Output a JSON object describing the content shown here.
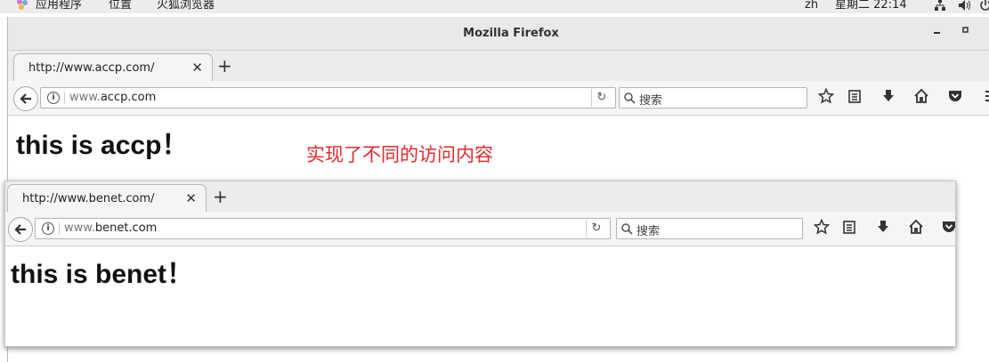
{
  "topbar": {
    "apps": "应用程序",
    "places": "位置",
    "browser": "火狐浏览器",
    "lang": "zh",
    "clock": "星期二 22:14"
  },
  "window": {
    "title": "Mozilla Firefox"
  },
  "browser1": {
    "tab_title": "http://www.accp.com/",
    "url_dim": "www.",
    "url_main": "accp.com",
    "search_placeholder": "搜索",
    "page_heading": "this is accp！"
  },
  "browser2": {
    "tab_title": "http://www.benet.com/",
    "url_dim": "www.",
    "url_main": "benet.com",
    "search_placeholder": "搜索",
    "page_heading": "this is benet！"
  },
  "annotation": "实现了不同的访问内容",
  "icons": [
    "apps-menu-icon",
    "network-icon",
    "volume-icon",
    "power-icon",
    "back-icon",
    "info-icon",
    "reload-icon",
    "search-icon",
    "bookmark-star-icon",
    "reading-list-icon",
    "download-icon",
    "home-icon",
    "pocket-icon",
    "menu-icon",
    "minimize-icon",
    "maximize-icon",
    "close-tab-icon",
    "new-tab-icon"
  ],
  "colors": {
    "annotation": "#e2292c",
    "chrome": "#ececec"
  }
}
